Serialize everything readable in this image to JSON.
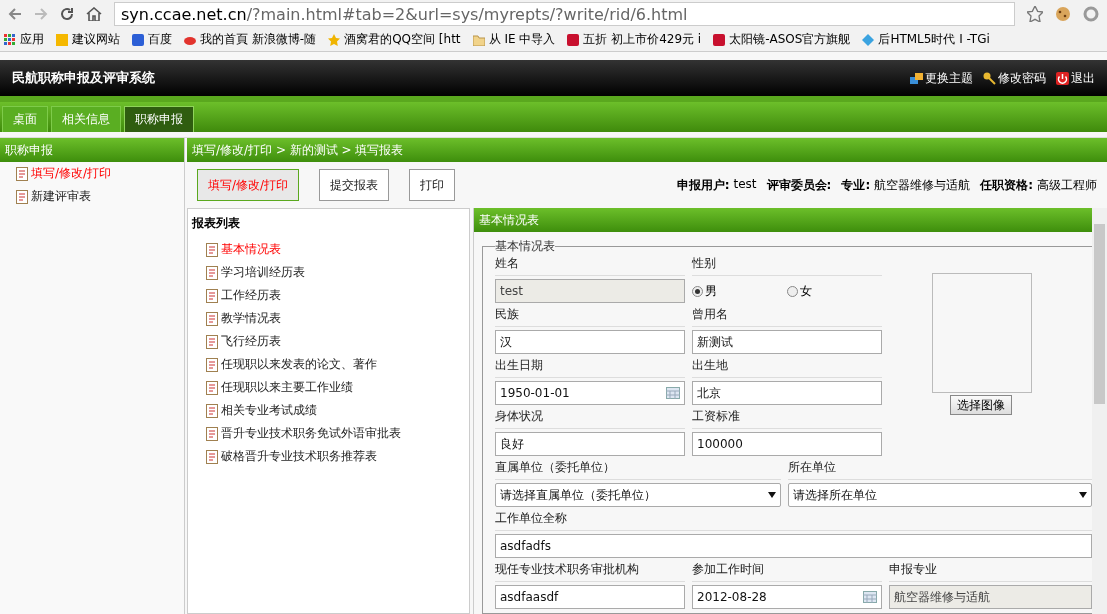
{
  "browser": {
    "url_host": "syn.ccae.net.cn",
    "url_path": "/?main.html#tab=2&url=sys/myrepts/?write/rid/6.html",
    "bookmarks": [
      {
        "label": "应用",
        "kind": "apps"
      },
      {
        "label": "建议网站",
        "kind": "bing"
      },
      {
        "label": "百度",
        "kind": "paw"
      },
      {
        "label": "我的首頁 新浪微博-随",
        "kind": "weibo"
      },
      {
        "label": "酒窝君的QQ空间 [htt",
        "kind": "star"
      },
      {
        "label": "从 IE 中导入",
        "kind": "folder"
      },
      {
        "label": "五折 初上市价429元 i",
        "kind": "t"
      },
      {
        "label": "太阳镜-ASOS官方旗舰",
        "kind": "t"
      },
      {
        "label": "后HTML5时代 I -TGi",
        "kind": "diamond"
      }
    ]
  },
  "app": {
    "title": "民航职称申报及评审系统",
    "actions": [
      {
        "label": "更换主题",
        "kind": "theme"
      },
      {
        "label": "修改密码",
        "kind": "key"
      },
      {
        "label": "退出",
        "kind": "power"
      }
    ],
    "tabs": [
      {
        "label": "桌面",
        "selected": false
      },
      {
        "label": "相关信息",
        "selected": false
      },
      {
        "label": "职称申报",
        "selected": true
      }
    ]
  },
  "sidebar": {
    "title": "职称申报",
    "items": [
      {
        "label": "填写/修改/打印",
        "selected": true
      },
      {
        "label": "新建评审表",
        "selected": false
      }
    ]
  },
  "breadcrumb": "填写/修改/打印 > 新的测试 > 填写报表",
  "toolbar": [
    {
      "label": "填写/修改/打印",
      "selected": true
    },
    {
      "label": "提交报表",
      "selected": false
    },
    {
      "label": "打印",
      "selected": false
    }
  ],
  "info": [
    {
      "label": "申报用户:",
      "value": "test"
    },
    {
      "label": "评审委员会:"
    },
    {
      "label": "专业:",
      "value": "航空器维修与适航"
    },
    {
      "label": "任职资格:",
      "value": "高级工程师"
    }
  ],
  "report_list": {
    "title": "报表列表",
    "items": [
      {
        "label": "基本情况表",
        "selected": true
      },
      {
        "label": "学习培训经历表",
        "selected": false
      },
      {
        "label": "工作经历表",
        "selected": false
      },
      {
        "label": "教学情况表",
        "selected": false
      },
      {
        "label": "飞行经历表",
        "selected": false
      },
      {
        "label": "任现职以来发表的论文、著作",
        "selected": false
      },
      {
        "label": "任现职以来主要工作业绩",
        "selected": false
      },
      {
        "label": "相关专业考试成绩",
        "selected": false
      },
      {
        "label": "晋升专业技术职务免试外语审批表",
        "selected": false
      },
      {
        "label": "破格晋升专业技术职务推荐表",
        "selected": false
      }
    ]
  },
  "form": {
    "panel_title": "基本情况表",
    "legend": "基本情况表",
    "name": {
      "label": "姓名",
      "value": "test",
      "disabled": true
    },
    "gender": {
      "label": "性别",
      "options": [
        {
          "label": "男",
          "selected": true
        },
        {
          "label": "女",
          "selected": false
        }
      ]
    },
    "rows": [
      [
        {
          "label": "民族",
          "value": "汉",
          "kind": "text"
        },
        {
          "label": "曾用名",
          "value": "新测试",
          "kind": "text"
        }
      ],
      [
        {
          "label": "出生日期",
          "value": "1950-01-01",
          "kind": "date"
        },
        {
          "label": "出生地",
          "value": "北京",
          "kind": "text"
        }
      ],
      [
        {
          "label": "身体状况",
          "value": "良好",
          "kind": "text"
        },
        {
          "label": "工资标准",
          "value": "100000",
          "kind": "text"
        }
      ]
    ],
    "photo_button": "选择图像",
    "selects": [
      {
        "label": "直属单位（委托单位）",
        "value": "请选择直属单位（委托单位）"
      },
      {
        "label": "所在单位",
        "value": "请选择所在单位"
      }
    ],
    "company": {
      "label": "工作单位全称",
      "value": "asdfadfs"
    },
    "last_row": [
      {
        "label": "现任专业技术职务审批机构",
        "value": "asdfaasdf",
        "kind": "text"
      },
      {
        "label": "参加工作时间",
        "value": "2012-08-28",
        "kind": "date"
      },
      {
        "label": "申报专业",
        "value": "航空器维修与适航",
        "kind": "readonly"
      }
    ]
  }
}
